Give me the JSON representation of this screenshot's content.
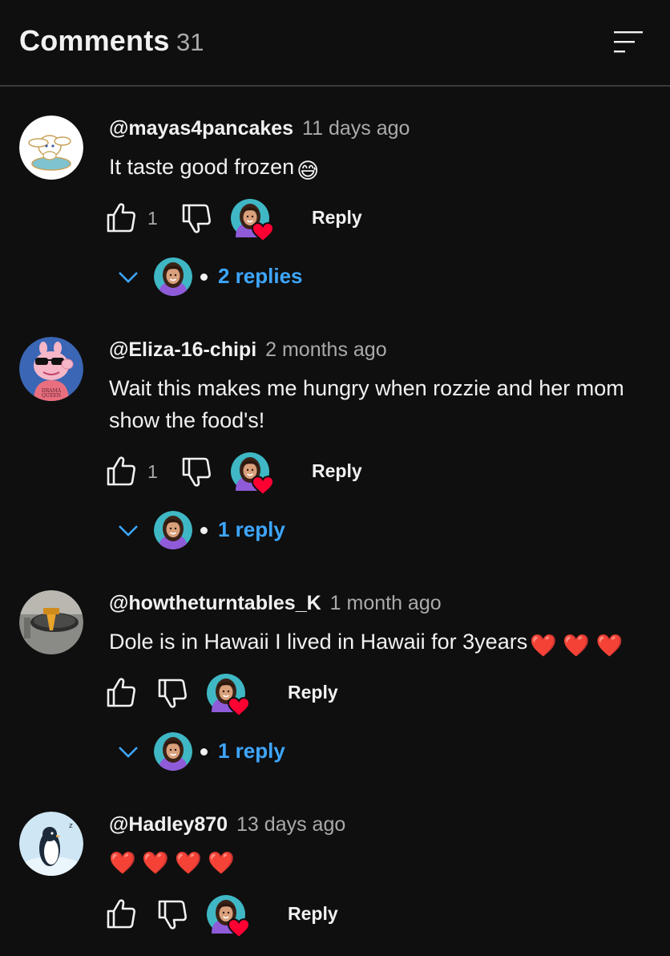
{
  "header": {
    "title": "Comments",
    "count": "31"
  },
  "comments": [
    {
      "author": "@mayas4pancakes",
      "time": "11 days ago",
      "text": "It taste good frozen",
      "emoji": "😅",
      "likes": "1",
      "reply_label": "Reply",
      "replies_label": "2 replies",
      "avatar": "cinnamoroll-avatar"
    },
    {
      "author": "@Eliza-16-chipi",
      "time": "2 months ago",
      "text": "Wait this makes me hungry when rozzie and her mom show the food's!",
      "likes": "1",
      "reply_label": "Reply",
      "replies_label": "1 reply",
      "avatar": "pig-drama-queen-avatar",
      "avatar_badge": "DRAMA QUEEN"
    },
    {
      "author": "@howtheturntables_K",
      "time": "1 month ago",
      "text": "Dole is in Hawaii I lived in Hawaii for 3years",
      "emoji": "❤️ ❤️ ❤️",
      "likes": "",
      "reply_label": "Reply",
      "replies_label": "1 reply",
      "avatar": "turntable-avatar"
    },
    {
      "author": "@Hadley870",
      "time": "13 days ago",
      "text": "❤️ ❤️ ❤️ ❤️",
      "likes": "",
      "reply_label": "Reply",
      "avatar": "penguin-avatar"
    }
  ],
  "colors": {
    "background": "#0f0f0f",
    "text": "#f1f1f1",
    "secondary": "#aaaaaa",
    "link": "#3ea6ff",
    "heart": "#ff0033"
  }
}
